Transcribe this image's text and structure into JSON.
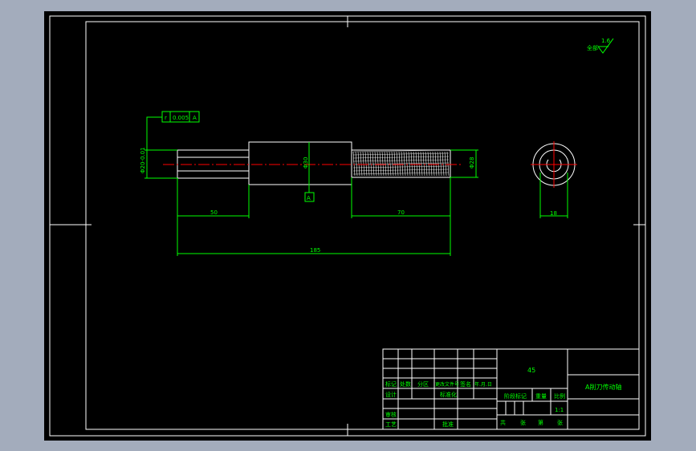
{
  "drawing": {
    "material": "45",
    "part_name": "A削刀传动轴",
    "scale": "1:1",
    "roughness_note": "全部",
    "roughness_value": "1.6"
  },
  "tolerance_frame": {
    "symbol": "r",
    "value": "0.005",
    "datum": "A"
  },
  "datum_label": "A",
  "dimensions": {
    "left_diameter": "Φ20-0.01",
    "mid_diameter": "Φ30",
    "right_diameter": "Φ28",
    "left_length": "50",
    "right_length": "70",
    "total_length": "185",
    "end_view_width": "18"
  },
  "title_block": {
    "rev_headers": [
      "标记",
      "处数",
      "分区",
      "更改文件号",
      "签名",
      "年.月.日"
    ],
    "role_design": "设计",
    "standardize": "标准化",
    "review": "审核",
    "process": "工艺",
    "approve": "批准",
    "stage_mark": "阶段标记",
    "weight": "重量",
    "scale_label": "比例",
    "total": "共",
    "sheets": "张",
    "page": "第",
    "page_unit": "张"
  },
  "colors": {
    "background": "#000000",
    "frame": "#ffffff",
    "annotation": "#00ff00",
    "centerline": "#ff0000",
    "outer": "#a3acbc"
  }
}
